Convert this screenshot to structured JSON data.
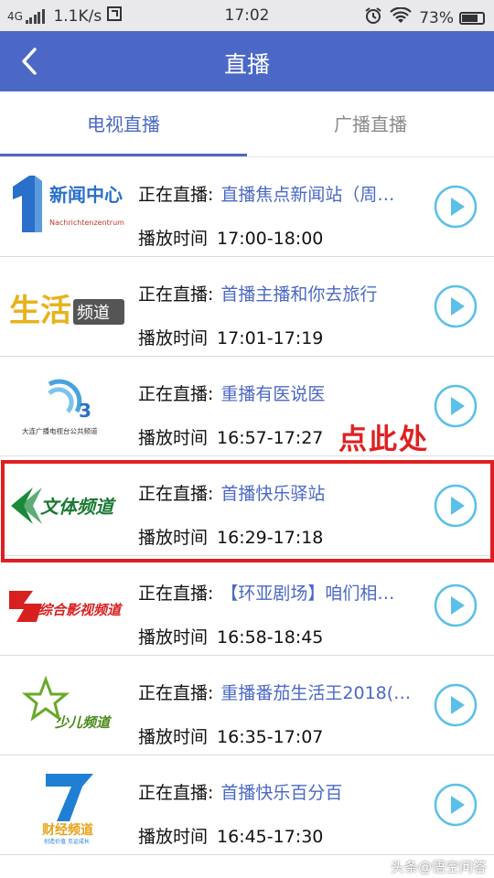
{
  "status_bar": {
    "network": "4G",
    "speed": "1.1K/s",
    "time": "17:02",
    "battery": "73%"
  },
  "app_bar": {
    "title": "直播"
  },
  "tabs": [
    {
      "label": "电视直播",
      "active": true
    },
    {
      "label": "广播直播",
      "active": false
    }
  ],
  "row_labels": {
    "now_playing": "正在直播:",
    "play_time": "播放时间"
  },
  "channels": [
    {
      "logo": "新闻中心",
      "logo_sub": "Nachrichtenzentrum",
      "program": "直播焦点新闻站（周…",
      "time": "17:00-18:00"
    },
    {
      "logo": "生活频道",
      "program": "首播主播和你去旅行",
      "time": "17:01-17:19"
    },
    {
      "logo": "大连广播电视台公共频道",
      "program": "重播有医说医",
      "time": "16:57-17:27"
    },
    {
      "logo": "文体频道",
      "program": "首播快乐驿站",
      "time": "16:29-17:18"
    },
    {
      "logo": "综合影视频道",
      "program": "【环亚剧场】咱们相…",
      "time": "16:58-18:45"
    },
    {
      "logo": "少儿频道",
      "program": "重播番茄生活王2018(…",
      "time": "16:35-17:07"
    },
    {
      "logo": "财经频道",
      "logo_sub": "创造价值 见证成长",
      "program": "首播快乐百分百",
      "time": "16:45-17:30"
    }
  ],
  "annotation": {
    "text": "点此处",
    "color": "#e02020"
  },
  "watermark": {
    "text": "头条@悟空问答"
  },
  "colors": {
    "accent": "#4b68c6",
    "play_icon": "#5bc0e8",
    "highlight": "#e02020"
  }
}
